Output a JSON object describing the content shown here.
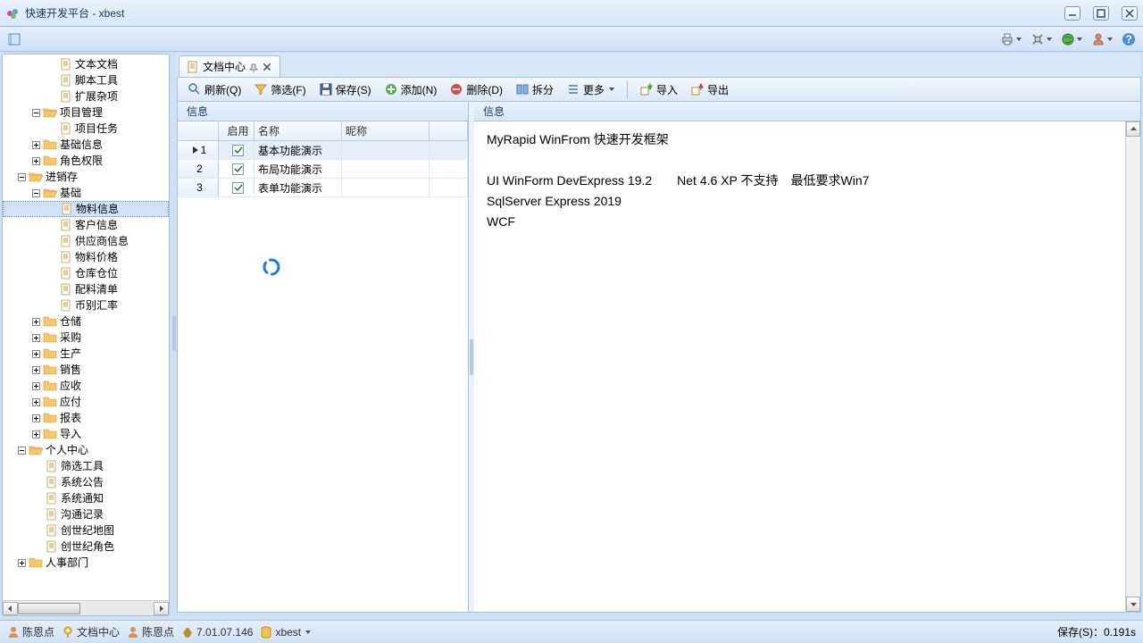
{
  "window": {
    "title": "快速开发平台 - xbest"
  },
  "rightIcons": [
    "printer",
    "tools",
    "world",
    "user",
    "help"
  ],
  "tree": [
    {
      "indent": 64,
      "type": "item",
      "label": "文本文档"
    },
    {
      "indent": 64,
      "type": "item",
      "label": "脚本工具"
    },
    {
      "indent": 64,
      "type": "item",
      "label": "扩展杂项"
    },
    {
      "indent": 32,
      "type": "folder",
      "expander": "minus",
      "open": true,
      "label": "项目管理"
    },
    {
      "indent": 64,
      "type": "item",
      "label": "项目任务"
    },
    {
      "indent": 32,
      "type": "folder",
      "expander": "plus",
      "label": "基础信息"
    },
    {
      "indent": 32,
      "type": "folder",
      "expander": "plus",
      "label": "角色权限"
    },
    {
      "indent": 16,
      "type": "folder",
      "expander": "minus",
      "open": true,
      "label": "进销存"
    },
    {
      "indent": 32,
      "type": "folder",
      "expander": "minus",
      "open": true,
      "label": "基础"
    },
    {
      "indent": 64,
      "type": "item",
      "label": "物料信息",
      "selected": true
    },
    {
      "indent": 64,
      "type": "item",
      "label": "客户信息"
    },
    {
      "indent": 64,
      "type": "item",
      "label": "供应商信息"
    },
    {
      "indent": 64,
      "type": "item",
      "label": "物料价格"
    },
    {
      "indent": 64,
      "type": "item",
      "label": "仓库仓位"
    },
    {
      "indent": 64,
      "type": "item",
      "label": "配料清单"
    },
    {
      "indent": 64,
      "type": "item",
      "label": "币别汇率"
    },
    {
      "indent": 32,
      "type": "folder",
      "expander": "plus",
      "label": "仓储"
    },
    {
      "indent": 32,
      "type": "folder",
      "expander": "plus",
      "label": "采购"
    },
    {
      "indent": 32,
      "type": "folder",
      "expander": "plus",
      "label": "生产"
    },
    {
      "indent": 32,
      "type": "folder",
      "expander": "plus",
      "label": "销售"
    },
    {
      "indent": 32,
      "type": "folder",
      "expander": "plus",
      "label": "应收"
    },
    {
      "indent": 32,
      "type": "folder",
      "expander": "plus",
      "label": "应付"
    },
    {
      "indent": 32,
      "type": "folder",
      "expander": "plus",
      "label": "报表"
    },
    {
      "indent": 32,
      "type": "folder",
      "expander": "plus",
      "label": "导入"
    },
    {
      "indent": 16,
      "type": "folder",
      "expander": "minus",
      "open": true,
      "label": "个人中心"
    },
    {
      "indent": 48,
      "type": "item",
      "label": "筛选工具"
    },
    {
      "indent": 48,
      "type": "item",
      "label": "系统公告"
    },
    {
      "indent": 48,
      "type": "item",
      "label": "系统通知"
    },
    {
      "indent": 48,
      "type": "item",
      "label": "沟通记录"
    },
    {
      "indent": 48,
      "type": "item",
      "label": "创世纪地图"
    },
    {
      "indent": 48,
      "type": "item",
      "label": "创世纪角色"
    },
    {
      "indent": 16,
      "type": "folder",
      "expander": "plus",
      "label": "人事部门"
    }
  ],
  "tab": {
    "label": "文档中心"
  },
  "toolbar": {
    "refresh": "刷新(Q)",
    "filter": "筛选(F)",
    "save": "保存(S)",
    "add": "添加(N)",
    "delete": "删除(D)",
    "split": "拆分",
    "more": "更多",
    "import": "导入",
    "export": "导出"
  },
  "leftPanel": {
    "header": "信息"
  },
  "gridHeaders": {
    "enable": "启用",
    "name": "名称",
    "nick": "昵称"
  },
  "gridRows": [
    {
      "num": "1",
      "enabled": true,
      "name": "基本功能演示",
      "nick": "",
      "selected": true,
      "indicator": true
    },
    {
      "num": "2",
      "enabled": true,
      "name": "布局功能演示",
      "nick": ""
    },
    {
      "num": "3",
      "enabled": true,
      "name": "表单功能演示",
      "nick": ""
    }
  ],
  "rightPanel": {
    "header": "信息"
  },
  "richText": [
    "MyRapid WinFrom 快速开发框架",
    "",
    "UI WinForm DevExpress 19.2　　Net 4.6  XP  不支持　最低要求Win7",
    "SqlServer Express 2019",
    "WCF"
  ],
  "status": {
    "user1": "陈恩点",
    "center": "文档中心",
    "user2": "陈恩点",
    "version": "7.01.07.146",
    "db": "xbest",
    "saveTime": "保存(S)：0.191s"
  }
}
